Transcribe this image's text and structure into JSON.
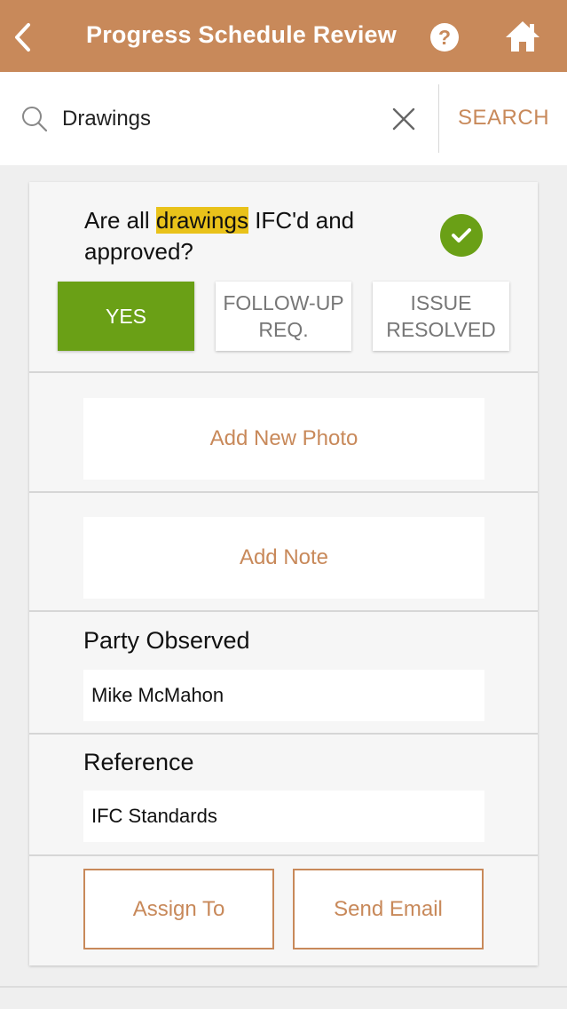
{
  "header": {
    "title": "Progress Schedule Review",
    "help_label": "?",
    "background_color": "#c8895a"
  },
  "search": {
    "value": "Drawings",
    "button_label": "SEARCH"
  },
  "question": {
    "text_before": "Are all ",
    "highlight": "drawings",
    "text_after": " IFC'd and approved?",
    "status": "complete"
  },
  "options": {
    "yes": "YES",
    "follow_up": "FOLLOW-UP REQ.",
    "resolved": "ISSUE RESOLVED",
    "selected": "yes"
  },
  "actions": {
    "add_photo": "Add New Photo",
    "add_note": "Add Note"
  },
  "fields": {
    "party_label": "Party Observed",
    "party_value": "Mike McMahon",
    "reference_label": "Reference",
    "reference_value": "IFC Standards"
  },
  "buttons": {
    "assign": "Assign To",
    "email": "Send Email"
  },
  "colors": {
    "accent": "#c8895a",
    "success": "#6aa016",
    "highlight": "#e9c21a"
  },
  "icons": [
    "back-arrow-icon",
    "help-icon",
    "home-icon",
    "search-icon",
    "close-icon",
    "checkmark-icon"
  ]
}
